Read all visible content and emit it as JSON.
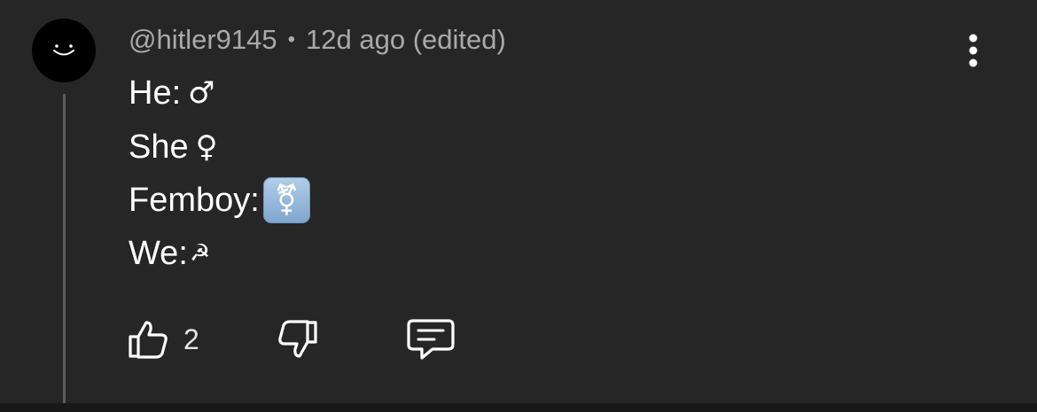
{
  "comment": {
    "author": "@hitler9145",
    "separator": "•",
    "time": "12d ago (edited)",
    "lines": [
      {
        "label": "He:",
        "symbol": "♂"
      },
      {
        "label": "She",
        "symbol": "♀"
      },
      {
        "label": "Femboy:",
        "symbol": "⚧"
      },
      {
        "label": "We:",
        "symbol": "☭"
      }
    ]
  },
  "actions": {
    "like_count": "2"
  },
  "icons": {
    "avatar": "smiley-avatar-icon",
    "more": "more-vertical-icon",
    "like": "thumbs-up-icon",
    "dislike": "thumbs-down-icon",
    "reply": "comment-icon",
    "transgender_emoji_bg": "#8fb3d9"
  }
}
